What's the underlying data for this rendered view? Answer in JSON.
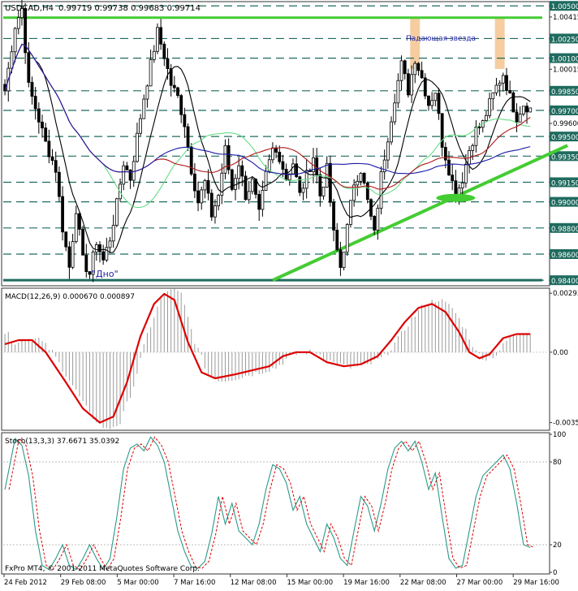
{
  "header": {
    "symbol_timeframe": "USDCAD,H4",
    "ohlc": "0.99719 0.99738 0.99683 0.99714"
  },
  "annotations": {
    "shooting_star": "Падающая звезда",
    "bottom": "\"Дно\""
  },
  "footer": "FxPro MT4, © 2001-2011 MetaQuotes Software Corp.",
  "colors": {
    "candle": "#000000",
    "dashed_level": "#1f6b5f",
    "green_line": "#44cc33",
    "blue_ma": "#1a1aa8",
    "red_ma": "#b01818",
    "black_ma": "#000000",
    "lightgreen_ma": "#66dd88",
    "macd_signal": "#dd0000",
    "macd_hist": "#9a9a9a",
    "stoch_main": "#2a9a8a",
    "stoch_signal": "#dd0000",
    "highlight": "#f5c896",
    "ask_label_bg": "#1f6b5f"
  },
  "chart_data": [
    {
      "type": "candlestick",
      "title": "USDCAD,H4",
      "ylim": [
        0.9837,
        1.0052
      ],
      "price_labels": [
        "1.00500",
        "1.00415",
        "1.00250",
        "1.00100",
        "1.00015",
        "0.99850",
        "0.99700",
        "0.99600",
        "0.99500",
        "0.99350",
        "0.99150",
        "0.99000",
        "0.98800",
        "0.98600",
        "0.98400"
      ],
      "boxed_levels": [
        1.005,
        1.0025,
        1.001,
        0.9985,
        0.997,
        0.995,
        0.9935,
        0.9915,
        0.99,
        0.988,
        0.986,
        0.984
      ],
      "plain_levels": [
        1.00415,
        1.00015,
        0.996
      ],
      "x_labels": [
        "24 Feb 2012",
        "29 Feb 08:00",
        "5 Mar 00:00",
        "7 Mar 16:00",
        "12 Mar 08:00",
        "15 Mar 00:00",
        "19 Mar 16:00",
        "22 Mar 08:00",
        "27 Mar 00:00",
        "29 Mar 16:00"
      ],
      "horizontal_lines": [
        1.0041,
        0.984
      ],
      "trendline": {
        "from": {
          "bar": 79,
          "price": 0.984
        },
        "to": {
          "bar": 160,
          "price": 0.9936
        }
      },
      "highlight_bars": [
        121,
        146
      ],
      "ovals": [
        {
          "bar": 133,
          "price": 0.9903
        }
      ],
      "close_path": [
        [
          0,
          0.9985
        ],
        [
          3,
          1.0035
        ],
        [
          5,
          1.0048
        ],
        [
          7,
          0.9988
        ],
        [
          9,
          0.9972
        ],
        [
          12,
          0.9945
        ],
        [
          15,
          0.9925
        ],
        [
          17,
          0.988
        ],
        [
          19,
          0.985
        ],
        [
          21,
          0.9895
        ],
        [
          23,
          0.9855
        ],
        [
          25,
          0.9845
        ],
        [
          27,
          0.987
        ],
        [
          29,
          0.9855
        ],
        [
          31,
          0.9872
        ],
        [
          33,
          0.9898
        ],
        [
          35,
          0.993
        ],
        [
          37,
          0.9918
        ],
        [
          39,
          0.995
        ],
        [
          41,
          0.998
        ],
        [
          43,
          1.0005
        ],
        [
          45,
          1.003
        ],
        [
          47,
          1.0012
        ],
        [
          49,
          0.999
        ],
        [
          51,
          0.998
        ],
        [
          53,
          0.996
        ],
        [
          55,
          0.9925
        ],
        [
          57,
          0.99
        ],
        [
          59,
          0.9915
        ],
        [
          61,
          0.989
        ],
        [
          63,
          0.9905
        ],
        [
          65,
          0.994
        ],
        [
          67,
          0.991
        ],
        [
          69,
          0.993
        ],
        [
          71,
          0.9905
        ],
        [
          73,
          0.9915
        ],
        [
          75,
          0.989
        ],
        [
          77,
          0.992
        ],
        [
          79,
          0.994
        ],
        [
          81,
          0.9935
        ],
        [
          83,
          0.9918
        ],
        [
          85,
          0.993
        ],
        [
          87,
          0.9905
        ],
        [
          89,
          0.992
        ],
        [
          91,
          0.9935
        ],
        [
          93,
          0.9905
        ],
        [
          95,
          0.9925
        ],
        [
          97,
          0.9875
        ],
        [
          99,
          0.985
        ],
        [
          101,
          0.988
        ],
        [
          103,
          0.9915
        ],
        [
          105,
          0.9925
        ],
        [
          107,
          0.99
        ],
        [
          109,
          0.9875
        ],
        [
          111,
          0.992
        ],
        [
          113,
          0.995
        ],
        [
          115,
          0.998
        ],
        [
          117,
          1.0005
        ],
        [
          119,
          0.9985
        ],
        [
          121,
          1.001
        ],
        [
          123,
          0.9995
        ],
        [
          125,
          0.9975
        ],
        [
          127,
          0.9985
        ],
        [
          129,
          0.9945
        ],
        [
          131,
          0.9925
        ],
        [
          133,
          0.9905
        ],
        [
          135,
          0.9918
        ],
        [
          137,
          0.994
        ],
        [
          139,
          0.9955
        ],
        [
          141,
          0.996
        ],
        [
          143,
          0.9975
        ],
        [
          145,
          0.9988
        ],
        [
          147,
          0.9998
        ],
        [
          149,
          0.998
        ],
        [
          151,
          0.9965
        ],
        [
          153,
          0.9975
        ],
        [
          155,
          0.9971
        ]
      ]
    },
    {
      "type": "macd",
      "title": "MACD(12,26,9) 0.000670 0.000897",
      "ylim": [
        -0.0038,
        0.0031
      ],
      "price_labels": [
        "0.00293",
        "0.00",
        "-0.00350"
      ],
      "signal_path": [
        [
          0,
          0.0004
        ],
        [
          4,
          0.0006
        ],
        [
          8,
          0.0006
        ],
        [
          12,
          0.0
        ],
        [
          18,
          -0.0015
        ],
        [
          23,
          -0.0028
        ],
        [
          28,
          -0.0035
        ],
        [
          32,
          -0.0032
        ],
        [
          36,
          -0.0015
        ],
        [
          40,
          0.0008
        ],
        [
          44,
          0.0024
        ],
        [
          47,
          0.0029
        ],
        [
          50,
          0.0026
        ],
        [
          54,
          0.0005
        ],
        [
          58,
          -0.001
        ],
        [
          62,
          -0.0013
        ],
        [
          68,
          -0.0011
        ],
        [
          73,
          -0.0009
        ],
        [
          78,
          -0.0007
        ],
        [
          82,
          -0.0002
        ],
        [
          86,
          0.0
        ],
        [
          90,
          0.0
        ],
        [
          95,
          -0.0005
        ],
        [
          100,
          -0.0007
        ],
        [
          105,
          -0.0006
        ],
        [
          110,
          -0.0002
        ],
        [
          114,
          0.0006
        ],
        [
          118,
          0.0015
        ],
        [
          122,
          0.0022
        ],
        [
          126,
          0.0024
        ],
        [
          130,
          0.002
        ],
        [
          134,
          0.001
        ],
        [
          137,
          0.0
        ],
        [
          140,
          -0.0003
        ],
        [
          143,
          -0.0001
        ],
        [
          147,
          0.0007
        ],
        [
          151,
          0.0009
        ],
        [
          155,
          0.0009
        ]
      ]
    },
    {
      "type": "stochastic",
      "title": "Stoch(13,3,3) 37.6671 35.0392",
      "ylim": [
        0,
        100
      ],
      "levels": [
        80,
        20
      ],
      "price_labels": [
        "100",
        "80",
        "20",
        "0"
      ],
      "main_path": [
        [
          0,
          60
        ],
        [
          3,
          97
        ],
        [
          5,
          92
        ],
        [
          7,
          70
        ],
        [
          9,
          30
        ],
        [
          11,
          5
        ],
        [
          13,
          2
        ],
        [
          15,
          10
        ],
        [
          17,
          20
        ],
        [
          19,
          5
        ],
        [
          21,
          2
        ],
        [
          23,
          10
        ],
        [
          25,
          20
        ],
        [
          27,
          10
        ],
        [
          29,
          2
        ],
        [
          31,
          10
        ],
        [
          33,
          40
        ],
        [
          35,
          75
        ],
        [
          37,
          90
        ],
        [
          39,
          93
        ],
        [
          41,
          88
        ],
        [
          43,
          98
        ],
        [
          45,
          92
        ],
        [
          47,
          80
        ],
        [
          49,
          55
        ],
        [
          51,
          30
        ],
        [
          53,
          15
        ],
        [
          55,
          4
        ],
        [
          57,
          3
        ],
        [
          59,
          8
        ],
        [
          61,
          28
        ],
        [
          63,
          55
        ],
        [
          65,
          35
        ],
        [
          67,
          50
        ],
        [
          69,
          30
        ],
        [
          71,
          25
        ],
        [
          73,
          20
        ],
        [
          75,
          35
        ],
        [
          77,
          60
        ],
        [
          79,
          78
        ],
        [
          81,
          75
        ],
        [
          83,
          65
        ],
        [
          85,
          45
        ],
        [
          87,
          55
        ],
        [
          89,
          35
        ],
        [
          91,
          25
        ],
        [
          93,
          15
        ],
        [
          95,
          35
        ],
        [
          97,
          25
        ],
        [
          99,
          10
        ],
        [
          101,
          5
        ],
        [
          103,
          30
        ],
        [
          105,
          55
        ],
        [
          107,
          48
        ],
        [
          109,
          30
        ],
        [
          111,
          50
        ],
        [
          113,
          75
        ],
        [
          115,
          90
        ],
        [
          117,
          95
        ],
        [
          119,
          88
        ],
        [
          121,
          95
        ],
        [
          123,
          80
        ],
        [
          125,
          60
        ],
        [
          127,
          72
        ],
        [
          129,
          40
        ],
        [
          131,
          10
        ],
        [
          133,
          3
        ],
        [
          135,
          5
        ],
        [
          137,
          30
        ],
        [
          139,
          55
        ],
        [
          141,
          70
        ],
        [
          143,
          75
        ],
        [
          145,
          80
        ],
        [
          147,
          85
        ],
        [
          149,
          75
        ],
        [
          151,
          50
        ],
        [
          153,
          20
        ],
        [
          155,
          18
        ]
      ]
    }
  ]
}
